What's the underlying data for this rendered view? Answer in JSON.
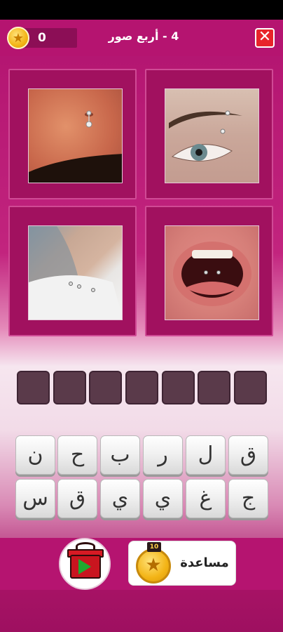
{
  "header": {
    "coins": "0",
    "level_title": "4 - أربع صور",
    "close_label": "✕"
  },
  "pictures": [
    {
      "name": "navel piercing photo"
    },
    {
      "name": "eyebrow piercing photo"
    },
    {
      "name": "collarbone piercing photo"
    },
    {
      "name": "tongue piercing photo"
    }
  ],
  "answer_slots": [
    "",
    "",
    "",
    "",
    "",
    "",
    ""
  ],
  "keyboard": {
    "row1": [
      "ق",
      "ل",
      "ر",
      "ب",
      "ح",
      "ن"
    ],
    "row2": [
      "ج",
      "غ",
      "ي",
      "ي",
      "ق",
      "س"
    ]
  },
  "bottom": {
    "help_label": "مساعدة",
    "help_cost": "10"
  },
  "colors": {
    "primary": "#b51470",
    "tile": "#a1115f",
    "coin": "#f3b416",
    "close": "#e8242a"
  }
}
